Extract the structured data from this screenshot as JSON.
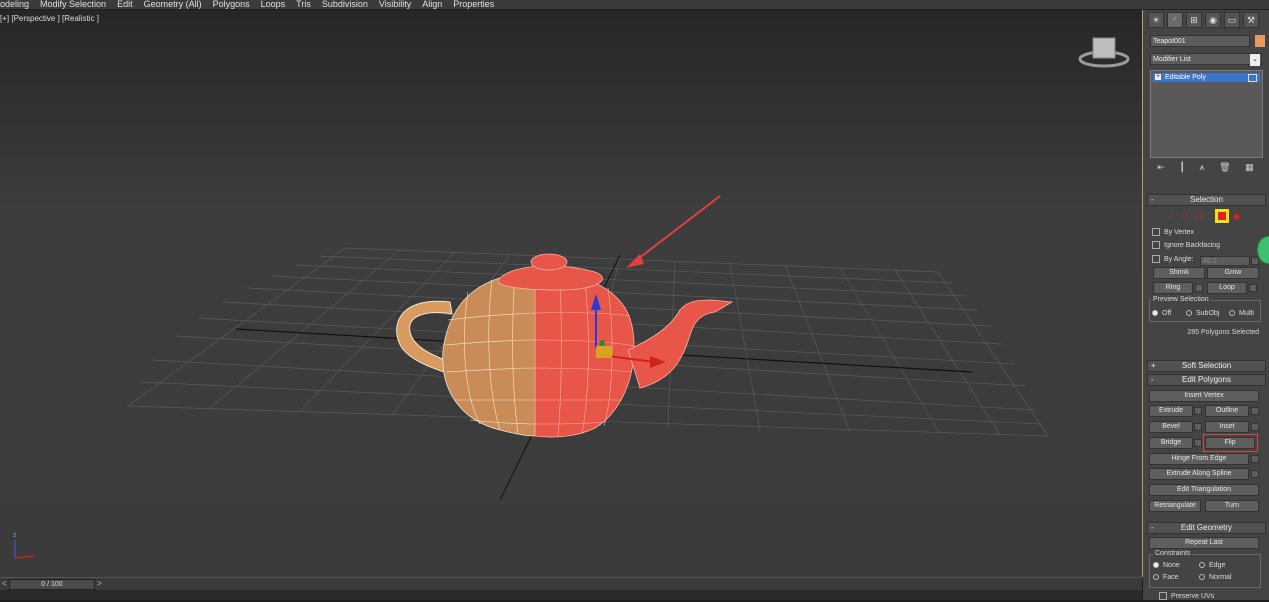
{
  "menu": [
    "odeling",
    "Modify Selection",
    "Edit",
    "Geometry (All)",
    "Polygons",
    "Loops",
    "Tris",
    "Subdivision",
    "Visibility",
    "Align",
    "Properties"
  ],
  "viewport": {
    "label": "[+] [Perspective ] [Realistic ]",
    "axis_z": "z"
  },
  "timeline": {
    "frame": "0 / 100",
    "prev": "<",
    "next": ">"
  },
  "panel": {
    "object_name": "Teapot001",
    "object_color": "#e79a5a",
    "modifier_list": "Modifier List",
    "stack_item": "Editable Poly",
    "selection": {
      "title": "Selection",
      "by_vertex": "By Vertex",
      "ignore_backfacing": "Ignore Backfacing",
      "by_angle": "By Angle:",
      "angle_value": "45.0",
      "shrink": "Shrink",
      "grow": "Grow",
      "ring": "Ring",
      "loop": "Loop",
      "preview_selection": "Preview Selection",
      "preview_off": "Off",
      "preview_subobj": "SubObj",
      "preview_multi": "Multi",
      "status": "285 Polygons Selected"
    },
    "soft_selection": "Soft Selection",
    "edit_polygons": {
      "title": "Edit Polygons",
      "insert_vertex": "Insert Vertex",
      "extrude": "Extrude",
      "outline": "Outline",
      "bevel": "Bevel",
      "inset": "Inset",
      "bridge": "Bridge",
      "flip": "Flip",
      "hinge_from_edge": "Hinge From Edge",
      "extrude_along_spline": "Extrude Along Spline",
      "edit_triangulation": "Edit Triangulation",
      "retriangulate": "Retriangulate",
      "turn": "Turn"
    },
    "edit_geometry": {
      "title": "Edit Geometry",
      "repeat_last": "Repeat Last",
      "constraints": "Constraints",
      "none": "None",
      "edge": "Edge",
      "face": "Face",
      "normal": "Normal",
      "preserve_uvs": "Preserve UVs"
    }
  },
  "colors": {
    "selected_polys": "#e8564a",
    "teapot_base": "#c98c57",
    "highlight": "#e04040"
  }
}
